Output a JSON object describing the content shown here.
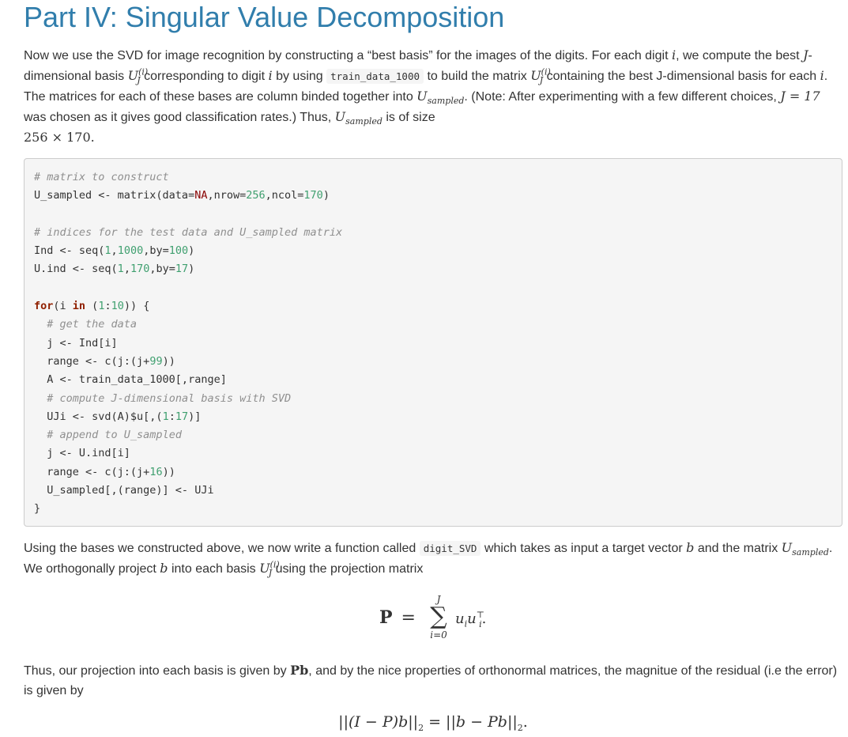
{
  "title": "Part IV: Singular Value Decomposition",
  "para1": {
    "t1": "Now we use the SVD for image recognition by constructing a “best basis” for the images of the digits. For each digit ",
    "i": "i",
    "t2": ", we compute the best ",
    "J": "J",
    "t3": "-dimensional basis ",
    "U": "U",
    "sub_J": "J",
    "sup_i": "(i)",
    "t4": " corresponding to digit ",
    "t5": " by using ",
    "code_train": "train_data_1000",
    "t6": " to build the matrix ",
    "t7": " containing the best J-dimensional basis for each ",
    "t8": ". The matrices for each of these bases are column binded together into ",
    "sub_sampled": "sampled",
    "t9": ". (Note: After experimenting with a few different choices, ",
    "J_eq": "J = 17",
    "t10": " was chosen as it gives good classification rates.) Thus, ",
    "t11": " is of size",
    "size": "256 × 170."
  },
  "code_lines": [
    [
      {
        "c": "cm",
        "t": "# matrix to construct"
      }
    ],
    [
      {
        "t": "U_sampled <- matrix(data="
      },
      {
        "c": "cs",
        "t": "NA"
      },
      {
        "t": ",nrow="
      },
      {
        "c": "nm",
        "t": "256"
      },
      {
        "t": ",ncol="
      },
      {
        "c": "nm",
        "t": "170"
      },
      {
        "t": ")"
      }
    ],
    [],
    [
      {
        "c": "cm",
        "t": "# indices for the test data and U_sampled matrix"
      }
    ],
    [
      {
        "t": "Ind <- seq("
      },
      {
        "c": "nm",
        "t": "1"
      },
      {
        "t": ","
      },
      {
        "c": "nm",
        "t": "1000"
      },
      {
        "t": ",by="
      },
      {
        "c": "nm",
        "t": "100"
      },
      {
        "t": ")"
      }
    ],
    [
      {
        "t": "U.ind <- seq("
      },
      {
        "c": "nm",
        "t": "1"
      },
      {
        "t": ","
      },
      {
        "c": "nm",
        "t": "170"
      },
      {
        "t": ",by="
      },
      {
        "c": "nm",
        "t": "17"
      },
      {
        "t": ")"
      }
    ],
    [],
    [
      {
        "c": "kw",
        "t": "for"
      },
      {
        "t": "(i "
      },
      {
        "c": "kw",
        "t": "in"
      },
      {
        "t": " ("
      },
      {
        "c": "nm",
        "t": "1"
      },
      {
        "t": ":"
      },
      {
        "c": "nm",
        "t": "10"
      },
      {
        "t": ")) {"
      }
    ],
    [
      {
        "t": "  "
      },
      {
        "c": "cm",
        "t": "# get the data"
      }
    ],
    [
      {
        "t": "  j <- Ind[i]"
      }
    ],
    [
      {
        "t": "  range <- c(j:(j+"
      },
      {
        "c": "nm",
        "t": "99"
      },
      {
        "t": "))"
      }
    ],
    [
      {
        "t": "  A <- train_data_1000[,range]"
      }
    ],
    [
      {
        "t": "  "
      },
      {
        "c": "cm",
        "t": "# compute J-dimensional basis with SVD"
      }
    ],
    [
      {
        "t": "  UJi <- svd(A)$u[,("
      },
      {
        "c": "nm",
        "t": "1"
      },
      {
        "t": ":"
      },
      {
        "c": "nm",
        "t": "17"
      },
      {
        "t": ")]"
      }
    ],
    [
      {
        "t": "  "
      },
      {
        "c": "cm",
        "t": "# append to U_sampled"
      }
    ],
    [
      {
        "t": "  j <- U.ind[i]"
      }
    ],
    [
      {
        "t": "  range <- c(j:(j+"
      },
      {
        "c": "nm",
        "t": "16"
      },
      {
        "t": "))"
      }
    ],
    [
      {
        "t": "  U_sampled[,(range)] <- UJi"
      }
    ],
    [
      {
        "t": "}"
      }
    ]
  ],
  "para2": {
    "t1": "Using the bases we constructed above, we now write a function called ",
    "code_fn": "digit_SVD",
    "t2": " which takes as input a target vector ",
    "b": "b",
    "t3": " and the matrix ",
    "t4": ". We orthogonally project ",
    "t5": " into each basis ",
    "t6": " using the projection matrix"
  },
  "eq1": {
    "lhs": "P",
    "equals": "=",
    "sum": "∑",
    "upper": "J",
    "lower": "i=0",
    "body": "u",
    "body_sub": "i",
    "body2": "u",
    "body2_sub": "i",
    "body2_sup": "⊤",
    "period": "."
  },
  "para3": {
    "t1": "Thus, our projection into each basis is given by ",
    "Pb": "Pb",
    "t2": ", and by the nice properties of orthonormal matrices, the magnitue of the residual (i.e the error) is given by"
  },
  "eq2": {
    "left": "||(I − P)b||",
    "sub2": "2",
    "mid": " = ||b − Pb||",
    "end": "."
  }
}
